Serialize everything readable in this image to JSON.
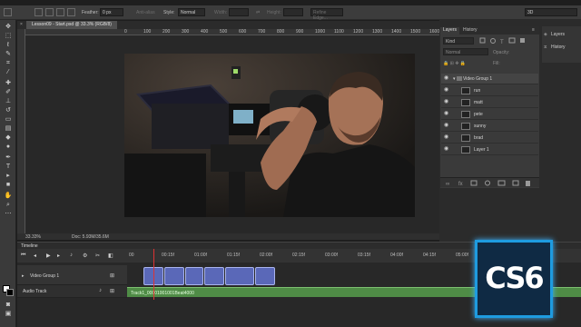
{
  "options_bar": {
    "feather_label": "Feather:",
    "feather_value": "0 px",
    "anti_alias": "Anti-alias",
    "style_label": "Style:",
    "style_value": "Normal",
    "width_label": "Width:",
    "height_label": "Height:",
    "refine_edge": "Refine Edge...",
    "workspace": "3D"
  },
  "document": {
    "tab_title": "Lesson09 - Start.psd @ 33.3% (RGB/8)",
    "ruler_ticks": [
      "0",
      "100",
      "200",
      "300",
      "400",
      "500",
      "600",
      "700",
      "800",
      "900",
      "1000",
      "1100",
      "1200",
      "1300",
      "1400",
      "1500",
      "1600",
      "1700",
      "1800",
      "1900"
    ],
    "zoom": "33.33%",
    "doc_size": "Doc: 5.93M/35.6M"
  },
  "layers_panel": {
    "tabs": [
      "Layers",
      "History"
    ],
    "kind_label": "Kind",
    "blend_mode": "Normal",
    "opacity_label": "Opacity:",
    "fill_label": "Fill:",
    "group_name": "Video Group 1",
    "layers": [
      "run",
      "matt",
      "pete",
      "sunny",
      "brad",
      "Layer 1"
    ]
  },
  "side_panel": {
    "buttons": [
      "Layers",
      "History"
    ]
  },
  "timeline": {
    "title": "Timeline",
    "times": [
      "00",
      "00:15f",
      "01:00f",
      "01:15f",
      "02:00f",
      "02:15f",
      "03:00f",
      "03:15f",
      "04:00f",
      "04:15f",
      "05:00f",
      "05:15f"
    ],
    "video_track": "Video Group 1",
    "audio_track": "Audio Track",
    "audio_clip": "Track1_00001001001Beat4000"
  },
  "badge": {
    "text": "CS6"
  },
  "colors": {
    "clip": "#5a68b8",
    "audio": "#4f8c46",
    "badge_border": "#1e9be0"
  }
}
